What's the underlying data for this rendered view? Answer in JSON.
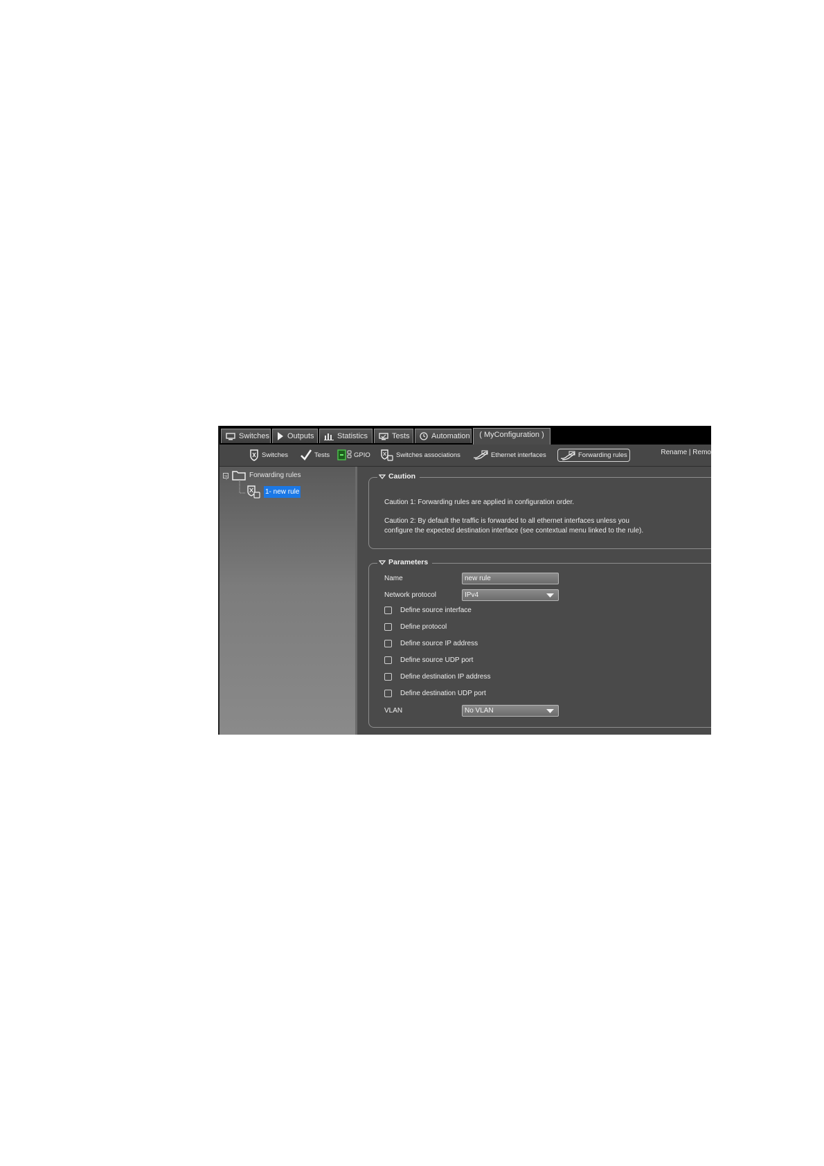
{
  "tabs": [
    {
      "label": "Switches",
      "icon": "monitor-icon"
    },
    {
      "label": "Outputs",
      "icon": "play-icon"
    },
    {
      "label": "Statistics",
      "icon": "bar-chart-icon"
    },
    {
      "label": "Tests",
      "icon": "screen-check-icon"
    },
    {
      "label": "Automation",
      "icon": "clock-icon"
    },
    {
      "label": "( MyConfiguration )",
      "active": true
    }
  ],
  "toolbar": {
    "switches": "Switches",
    "tests": "Tests",
    "gpio": "GPIO",
    "switches_associations": "Switches associations",
    "ethernet_interfaces": "Ethernet interfaces",
    "forwarding_rules": "Forwarding rules",
    "rename_remove": "Rename | Remo"
  },
  "tree": {
    "root_label": "Forwarding rules",
    "root_expander": "−",
    "child_label": "1- new rule"
  },
  "caution": {
    "title": "Caution",
    "line1": "Caution 1: Forwarding rules are applied in configuration order.",
    "line2a": "Caution 2: By default the traffic is forwarded to all ethernet interfaces unless you",
    "line2b": "configure the expected destination interface (see contextual menu linked to the rule)."
  },
  "parameters": {
    "title": "Parameters",
    "name_label": "Name",
    "name_value": "new rule",
    "protocol_label": "Network protocol",
    "protocol_value": "IPv4",
    "checkboxes": [
      "Define source interface",
      "Define protocol",
      "Define source IP address",
      "Define source UDP port",
      "Define destination IP address",
      "Define destination UDP port"
    ],
    "vlan_label": "VLAN",
    "vlan_value": "No VLAN"
  },
  "colors": {
    "selection": "#1b78e6",
    "panel_bg": "#4a4a4a",
    "tab_bar": "#000000"
  }
}
